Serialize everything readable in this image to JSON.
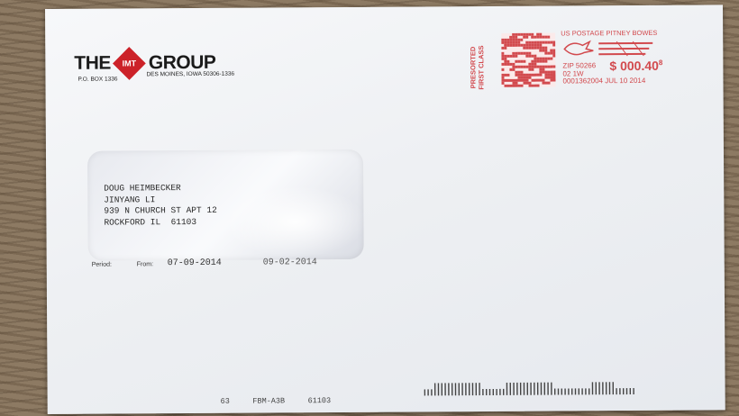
{
  "logo": {
    "the": "THE",
    "imt": "IMT",
    "group": "GROUP",
    "po_box": "P.O. BOX 1336",
    "city": "DES MOINES, IOWA 50306-1336"
  },
  "postage": {
    "indicia_line1": "PRESORTED",
    "indicia_line2": "FIRST CLASS",
    "header": "US POSTAGE  PITNEY BOWES",
    "zip": "ZIP 50266",
    "amount": "$ 000.40",
    "amount_sup": "8",
    "line2": "02 1W",
    "line3": "0001362004 JUL 10 2014"
  },
  "address": {
    "lines": [
      "DOUG HEIMBECKER",
      "JINYANG LI",
      "939 N CHURCH ST APT 12",
      "ROCKFORD IL  61103"
    ]
  },
  "period": {
    "label": "Period:",
    "from_label": "From:",
    "from": "07-09-2014",
    "to": "09-02-2014"
  },
  "footer": {
    "code1": "63",
    "code2": "FBM-A3B",
    "code3": "61103"
  },
  "colors": {
    "postage_red": "#d24a4e",
    "logo_red": "#cc2229"
  }
}
